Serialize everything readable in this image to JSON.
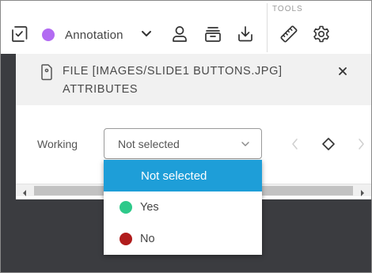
{
  "toolbar": {
    "mode_label": "Annotation",
    "mode_color": "#b26bf2",
    "tools_label": "TOOLS",
    "icons": [
      "checkbox-icon",
      "chevron-down-icon",
      "user-icon",
      "stack-icon",
      "download-icon",
      "ruler-icon",
      "gear-icon"
    ]
  },
  "panel": {
    "title": "FILE [IMAGES/SLIDE1 BUTTONS.JPG] ATTRIBUTES",
    "attribute_label": "Working",
    "select_value": "Not selected"
  },
  "dropdown": {
    "options": [
      {
        "label": "Not selected",
        "color": ""
      },
      {
        "label": "Yes",
        "color": "#2ec98a"
      },
      {
        "label": "No",
        "color": "#b01c1c"
      }
    ],
    "selected_color": "#1e9ed8"
  }
}
